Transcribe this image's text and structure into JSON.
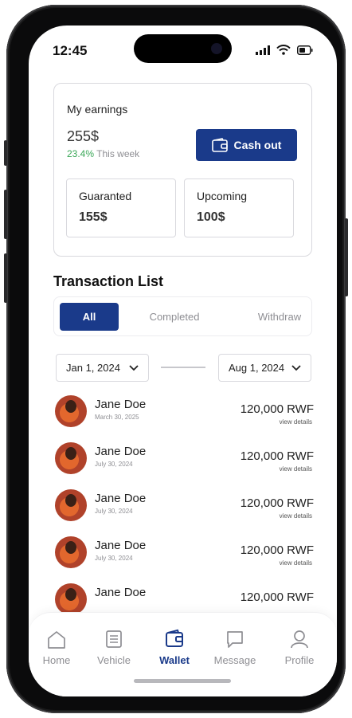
{
  "status": {
    "time": "12:45"
  },
  "earnings": {
    "label": "My earnings",
    "amount": "255$",
    "growth_pct": "23.4%",
    "growth_period": "This week",
    "cashout_label": "Cash out",
    "guaranteed_label": "Guaranted",
    "guaranteed_value": "155$",
    "upcoming_label": "Upcoming",
    "upcoming_value": "100$"
  },
  "transactions": {
    "title": "Transaction List",
    "tabs": [
      "All",
      "Completed",
      "Withdraw"
    ],
    "active_tab": "All",
    "date_from": "Jan 1, 2024",
    "date_to": "Aug 1, 2024",
    "items": [
      {
        "name": "Jane Doe",
        "date": "March 30, 2025",
        "amount": "120,000 RWF",
        "link": "view details"
      },
      {
        "name": "Jane Doe",
        "date": "July 30, 2024",
        "amount": "120,000 RWF",
        "link": "view details"
      },
      {
        "name": "Jane Doe",
        "date": "July 30, 2024",
        "amount": "120,000 RWF",
        "link": "view details"
      },
      {
        "name": "Jane Doe",
        "date": "July 30, 2024",
        "amount": "120,000 RWF",
        "link": "view details"
      },
      {
        "name": "Jane Doe",
        "date": "",
        "amount": "120,000 RWF",
        "link": ""
      }
    ]
  },
  "nav": {
    "items": [
      {
        "label": "Home",
        "icon": "home-icon"
      },
      {
        "label": "Vehicle",
        "icon": "document-icon"
      },
      {
        "label": "Wallet",
        "icon": "wallet-icon"
      },
      {
        "label": "Message",
        "icon": "message-icon"
      },
      {
        "label": "Profile",
        "icon": "profile-icon"
      }
    ],
    "active": "Wallet"
  },
  "colors": {
    "primary": "#1a3a8a",
    "positive": "#3aa757",
    "muted": "#8e8e93"
  }
}
